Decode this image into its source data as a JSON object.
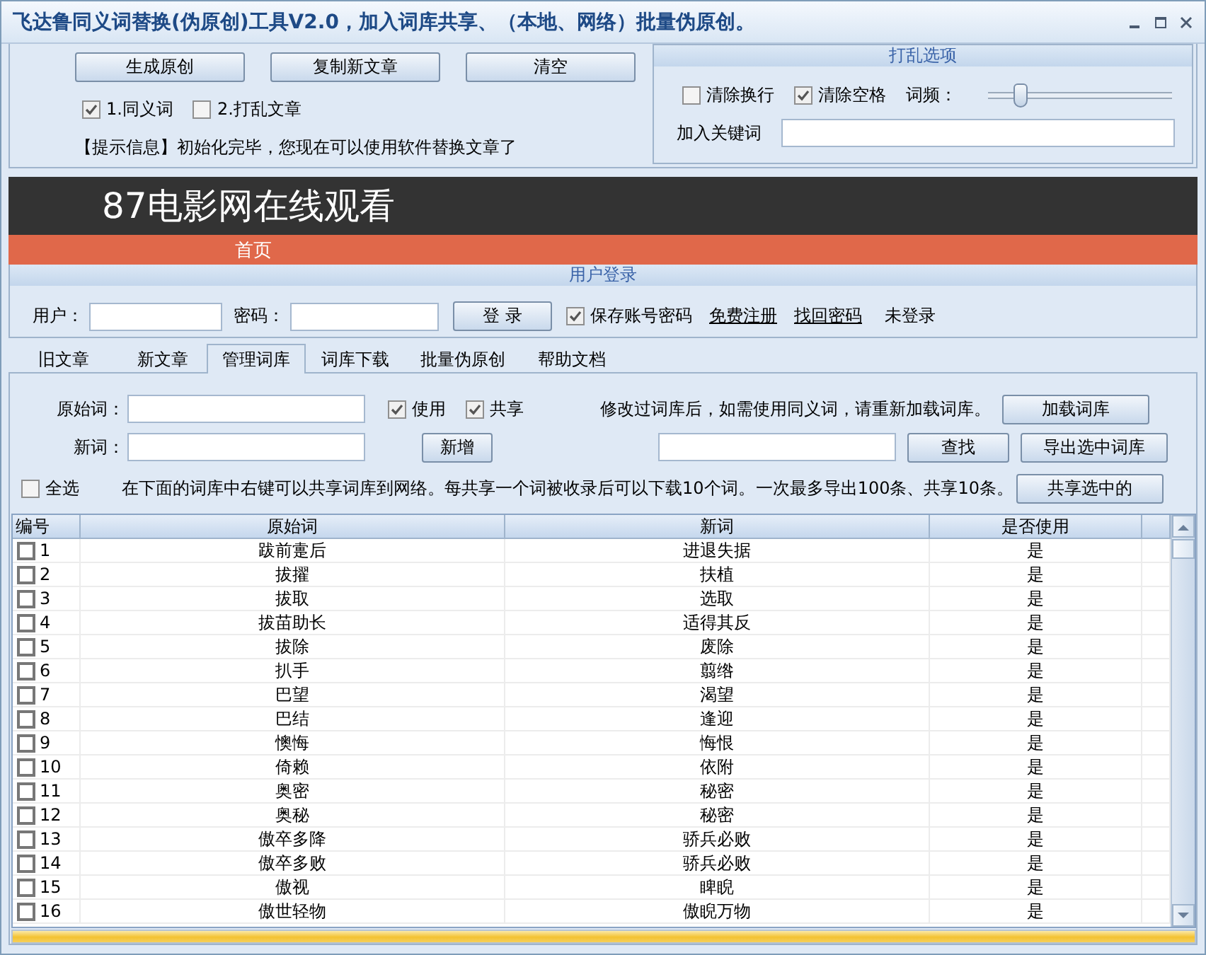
{
  "window": {
    "title": "飞达鲁同义词替换(伪原创)工具V2.0，加入词库共享、（本地、网络）批量伪原创。"
  },
  "actions": {
    "buttons": [
      "生成原创",
      "复制新文章",
      "清空"
    ],
    "options": [
      {
        "label": "1.同义词",
        "checked": true
      },
      {
        "label": "2.打乱文章",
        "checked": false
      }
    ],
    "info": "【提示信息】初始化完毕，您现在可以使用软件替换文章了"
  },
  "shuffle_options": {
    "title": "打乱选项",
    "options": [
      {
        "label": "清除换行",
        "checked": false
      },
      {
        "label": "清除空格",
        "checked": true
      }
    ],
    "frequency": {
      "label": "词频：",
      "level": 0.15
    },
    "keyword": {
      "label": "加入关键词"
    }
  },
  "banner": {
    "title": "87电影网在线观看",
    "nav": [
      "首页"
    ]
  },
  "login": {
    "title": "用户登录",
    "user_label": "用户：",
    "password_label": "密码：",
    "button": "登 录",
    "remember": {
      "label": "保存账号密码",
      "checked": true
    },
    "links": [
      "免费注册",
      "找回密码"
    ],
    "status": "未登录"
  },
  "tabs": [
    {
      "label": "旧文章",
      "selected": false
    },
    {
      "label": "新文章",
      "selected": false
    },
    {
      "label": "管理词库",
      "selected": true
    },
    {
      "label": "词库下载",
      "selected": false
    },
    {
      "label": "批量伪原创",
      "selected": false
    },
    {
      "label": "帮助文档",
      "selected": false
    }
  ],
  "editor": {
    "original_label": "原始词：",
    "new_label": "新词：",
    "use": {
      "label": "使用",
      "checked": true
    },
    "share": {
      "label": "共享",
      "checked": true
    },
    "add_button": "新增",
    "reload_note": "修改过词库后，如需使用同义词，请重新加载词库。",
    "reload_button": "加载词库",
    "search_button": "查找",
    "export_button": "导出选中词库",
    "select_all": {
      "label": "全选",
      "checked": false
    },
    "share_hint": "在下面的词库中右键可以共享词库到网络。每共享一个词被收录后可以下载10个词。",
    "limit_note": "一次最多导出100条、共享10条。",
    "share_button": "共享选中的"
  },
  "table": {
    "columns": [
      "编号",
      "原始词",
      "新词",
      "是否使用"
    ],
    "rows": [
      {
        "no": "1",
        "original": "跋前疐后",
        "new": "进退失据",
        "used": "是",
        "checked": false
      },
      {
        "no": "2",
        "original": "拔擢",
        "new": "扶植",
        "used": "是",
        "checked": false
      },
      {
        "no": "3",
        "original": "拔取",
        "new": "选取",
        "used": "是",
        "checked": false
      },
      {
        "no": "4",
        "original": "拔苗助长",
        "new": "适得其反",
        "used": "是",
        "checked": false
      },
      {
        "no": "5",
        "original": "拔除",
        "new": "废除",
        "used": "是",
        "checked": false
      },
      {
        "no": "6",
        "original": "扒手",
        "new": "翦绺",
        "used": "是",
        "checked": false
      },
      {
        "no": "7",
        "original": "巴望",
        "new": "渴望",
        "used": "是",
        "checked": false
      },
      {
        "no": "8",
        "original": "巴结",
        "new": "逢迎",
        "used": "是",
        "checked": false
      },
      {
        "no": "9",
        "original": "懊悔",
        "new": "悔恨",
        "used": "是",
        "checked": false
      },
      {
        "no": "10",
        "original": "倚赖",
        "new": "依附",
        "used": "是",
        "checked": false
      },
      {
        "no": "11",
        "original": "奥密",
        "new": "秘密",
        "used": "是",
        "checked": false
      },
      {
        "no": "12",
        "original": "奥秘",
        "new": "秘密",
        "used": "是",
        "checked": false
      },
      {
        "no": "13",
        "original": "傲卒多降",
        "new": "骄兵必败",
        "used": "是",
        "checked": false
      },
      {
        "no": "14",
        "original": "傲卒多败",
        "new": "骄兵必败",
        "used": "是",
        "checked": false
      },
      {
        "no": "15",
        "original": "傲视",
        "new": "睥睨",
        "used": "是",
        "checked": false
      },
      {
        "no": "16",
        "original": "傲世轻物",
        "new": "傲睨万物",
        "used": "是",
        "checked": false
      }
    ]
  },
  "progress": {
    "level": 1
  }
}
